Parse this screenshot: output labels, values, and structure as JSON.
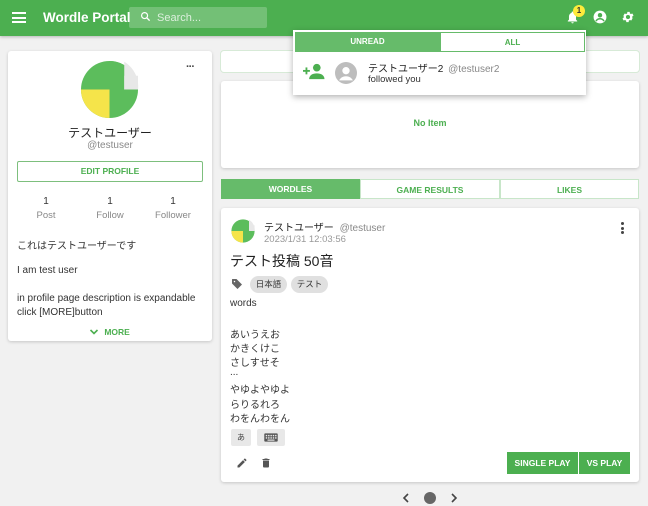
{
  "header": {
    "title": "Wordle Portal",
    "search_placeholder": "Search...",
    "notification_count": "1",
    "icons": [
      "menu-icon",
      "search-icon",
      "bell-icon",
      "account-icon",
      "gear-icon"
    ],
    "accent_color": "#4caf50"
  },
  "profile": {
    "name": "テストユーザー",
    "handle": "@testuser",
    "edit_label": "EDIT PROFILE",
    "stats": [
      {
        "count": "1",
        "label": "Post"
      },
      {
        "count": "1",
        "label": "Follow"
      },
      {
        "count": "1",
        "label": "Follower"
      }
    ],
    "description": [
      "これはテストユーザーです",
      "I am test user",
      "in profile page description is expandable",
      "click [MORE]button"
    ],
    "more_label": "MORE"
  },
  "game_results": {
    "empty_text": "No Item"
  },
  "tabs": [
    {
      "label": "WORDLES",
      "active": true
    },
    {
      "label": "GAME RESULTS",
      "active": false
    },
    {
      "label": "LIKES",
      "active": false
    }
  ],
  "post": {
    "author_name": "テストユーザー",
    "author_handle": "@testuser",
    "date": "2023/1/31 12:03:56",
    "title": "テスト投稿 50音",
    "tags": [
      "日本語",
      "テスト"
    ],
    "body_label": "words",
    "lines": [
      "あいうえお",
      "かきくけこ",
      "さしすせそ",
      "...",
      "やゆよやゆよ",
      "らりるれろ",
      "わをんわをん"
    ],
    "keys": [
      "あ",
      "keyboard-icon"
    ],
    "single_play_label": "SINGLE PLAY",
    "vs_play_label": "VS PLAY"
  },
  "notifications": {
    "tabs": [
      {
        "label": "UNREAD",
        "active": true
      },
      {
        "label": "ALL",
        "active": false
      }
    ],
    "items": [
      {
        "name": "テストユーザー2",
        "handle": "@testuser2",
        "message": "followed you"
      }
    ]
  },
  "pagination": {
    "pages": 1,
    "current": 1
  }
}
